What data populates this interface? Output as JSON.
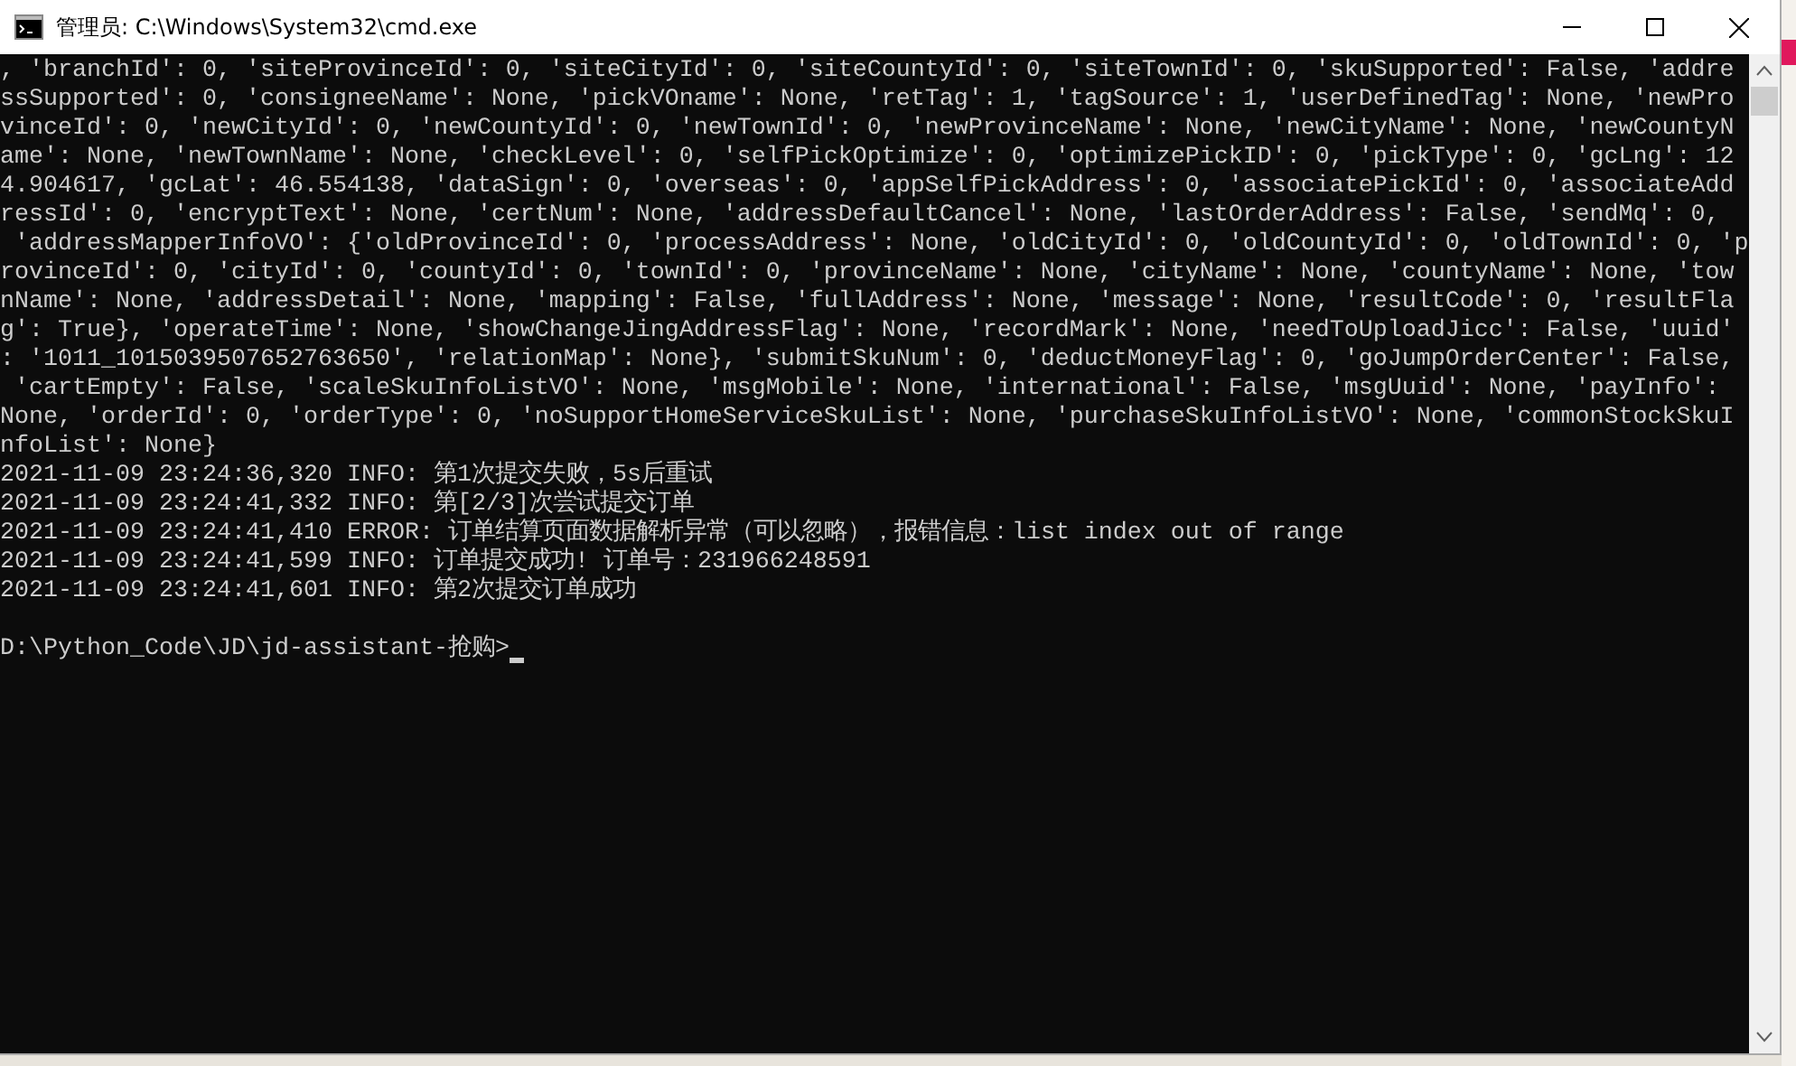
{
  "window": {
    "title": "管理员: C:\\Windows\\System32\\cmd.exe"
  },
  "console": {
    "lines": [
      ", 'branchId': 0, 'siteProvinceId': 0, 'siteCityId': 0, 'siteCountyId': 0, 'siteTownId': 0, 'skuSupported': False, 'addre",
      "ssSupported': 0, 'consigneeName': None, 'pickVOname': None, 'retTag': 1, 'tagSource': 1, 'userDefinedTag': None, 'newPro",
      "vinceId': 0, 'newCityId': 0, 'newCountyId': 0, 'newTownId': 0, 'newProvinceName': None, 'newCityName': None, 'newCountyN",
      "ame': None, 'newTownName': None, 'checkLevel': 0, 'selfPickOptimize': 0, 'optimizePickID': 0, 'pickType': 0, 'gcLng': 12",
      "4.904617, 'gcLat': 46.554138, 'dataSign': 0, 'overseas': 0, 'appSelfPickAddress': 0, 'associatePickId': 0, 'associateAdd",
      "ressId': 0, 'encryptText': None, 'certNum': None, 'addressDefaultCancel': None, 'lastOrderAddress': False, 'sendMq': 0,",
      " 'addressMapperInfoVO': {'oldProvinceId': 0, 'processAddress': None, 'oldCityId': 0, 'oldCountyId': 0, 'oldTownId': 0, 'p",
      "rovinceId': 0, 'cityId': 0, 'countyId': 0, 'townId': 0, 'provinceName': None, 'cityName': None, 'countyName': None, 'tow",
      "nName': None, 'addressDetail': None, 'mapping': False, 'fullAddress': None, 'message': None, 'resultCode': 0, 'resultFla",
      "g': True}, 'operateTime': None, 'showChangeJingAddressFlag': None, 'recordMark': None, 'needToUploadJicc': False, 'uuid'",
      ": '1011_1015039507652763650', 'relationMap': None}, 'submitSkuNum': 0, 'deductMoneyFlag': 0, 'goJumpOrderCenter': False,",
      " 'cartEmpty': False, 'scaleSkuInfoListVO': None, 'msgMobile': None, 'international': False, 'msgUuid': None, 'payInfo':",
      "None, 'orderId': 0, 'orderType': 0, 'noSupportHomeServiceSkuList': None, 'purchaseSkuInfoListVO': None, 'commonStockSkuI",
      "nfoList': None}",
      "2021-11-09 23:24:36,320 INFO: 第1次提交失败，5s后重试",
      "2021-11-09 23:24:41,332 INFO: 第[2/3]次尝试提交订单",
      "2021-11-09 23:24:41,410 ERROR: 订单结算页面数据解析异常（可以忽略），报错信息：list index out of range",
      "2021-11-09 23:24:41,599 INFO: 订单提交成功! 订单号：231966248591",
      "2021-11-09 23:24:41,601 INFO: 第2次提交订单成功"
    ],
    "prompt": "D:\\Python_Code\\JD\\jd-assistant-抢购>"
  }
}
